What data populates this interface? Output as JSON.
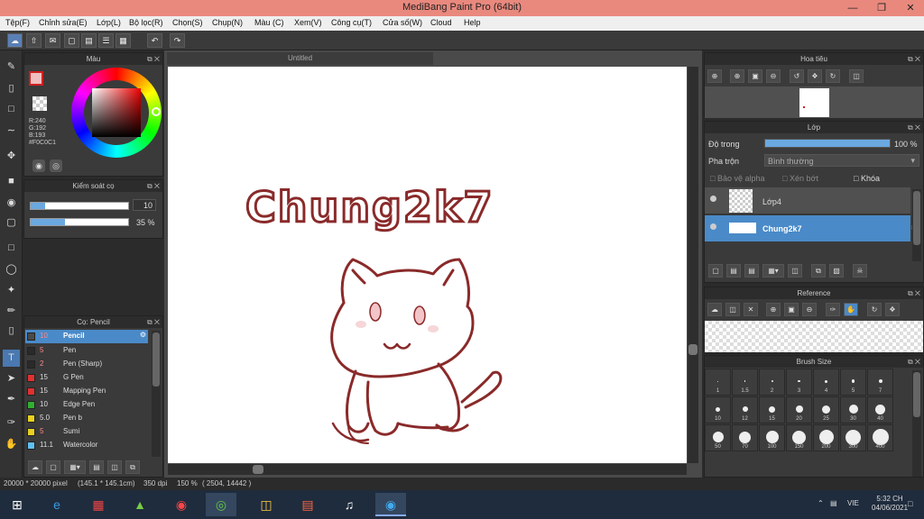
{
  "app": {
    "title": "MediBang Paint Pro (64bit)"
  },
  "menu": [
    "Tệp(F)",
    "Chỉnh sửa(E)",
    "Lớp(L)",
    "Bộ lọc(R)",
    "Chọn(S)",
    "Chụp(N)",
    "Màu (C)",
    "Xem(V)",
    "Công cụ(T)",
    "Cửa số(W)",
    "Cloud",
    "Help"
  ],
  "color_panel": {
    "title": "Màu",
    "r": "R:240",
    "g": "G:192",
    "b": "B:193",
    "hex": "#F0C0C1"
  },
  "brush_control": {
    "title": "Kiểm soát cọ",
    "size": "10",
    "opacity": "35 %"
  },
  "brush_list": {
    "title": "Cọ: Pencil",
    "items": [
      {
        "size": "10",
        "name": "Pencil",
        "color": "#4a4a4a"
      },
      {
        "size": "5",
        "name": "Pen",
        "color": "#2a2a2a"
      },
      {
        "size": "2",
        "name": "Pen (Sharp)",
        "color": "#2a2a2a"
      },
      {
        "size": "15",
        "name": "G Pen",
        "color": "#e03030"
      },
      {
        "size": "15",
        "name": "Mapping Pen",
        "color": "#e03030"
      },
      {
        "size": "10",
        "name": "Edge Pen",
        "color": "#30b030"
      },
      {
        "size": "5.0",
        "name": "Pen b",
        "color": "#e8d020"
      },
      {
        "size": "5",
        "name": "Sumi",
        "color": "#e8d020"
      },
      {
        "size": "11.1",
        "name": "Watercolor",
        "color": "#60c0f0"
      }
    ]
  },
  "document": {
    "tab": "Untitled",
    "canvas_text": "Chung2k7"
  },
  "navigator": {
    "title": "Hoa tiêu"
  },
  "layer_panel": {
    "title": "Lớp",
    "opacity_label": "Độ trong",
    "opacity_value": "100 %",
    "opacity_fraction": 1.0,
    "blend_label": "Pha trộn",
    "blend_value": "Bình thường",
    "protect_alpha": "Bảo vệ alpha",
    "clipping": "Xén bớt",
    "lock": "Khóa",
    "layers": [
      {
        "name": "Lớp4"
      },
      {
        "name": "Chung2k7"
      }
    ]
  },
  "reference": {
    "title": "Reference"
  },
  "brush_size": {
    "title": "Brush Size",
    "sizes": [
      "1",
      "1.5",
      "2",
      "3",
      "4",
      "5",
      "7",
      "10",
      "12",
      "15",
      "20",
      "25",
      "30",
      "40",
      "50",
      "70",
      "100",
      "150",
      "200",
      "300",
      "400"
    ]
  },
  "status": {
    "canvas_size": "20000 * 20000 pixel",
    "cm": "(145.1 * 145.1cm)",
    "dpi": "350 dpi",
    "zoom": "150 %",
    "coords": "( 2504, 14442 )"
  },
  "taskbar": {
    "lang": "VIE",
    "time": "5:32 CH",
    "date": "04/06/2021"
  },
  "opacity_fill": 0.35,
  "size_fill": 0.15
}
